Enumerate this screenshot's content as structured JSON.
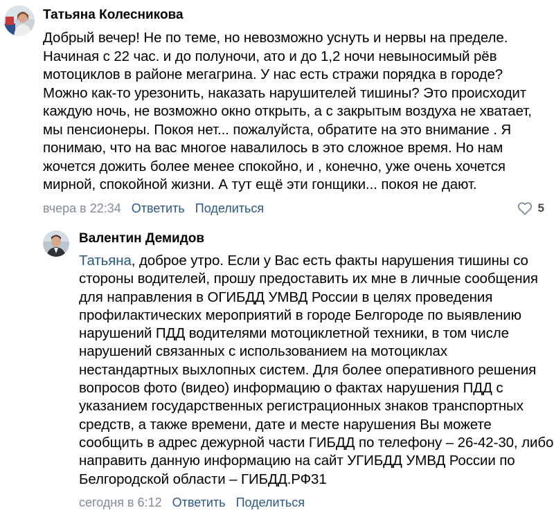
{
  "comments": [
    {
      "author": "Татьяна Колесникова",
      "lines": [
        "Добрый вечер! Не по теме, но невозможно уснуть и нервы на пределе.",
        "Начиная с 22 час. и до полуночи, ато и до 1,2 ночи невыносимый рёв",
        "мотоциклов в районе мегагрина. У нас есть стражи порядка в городе?",
        "Можно как-то урезонить, наказать нарушителей тишины? Это происходит",
        "каждую ночь, не возможно окно открыть, а с закрытым воздуха не хватает,",
        "мы пенсионеры. Покоя нет... пожалуйста, обратите на это внимание . Я",
        "понимаю, что на вас многое навалилось в это сложное время. Но нам",
        "жочется дожить более менее спокойно, и , конечно, уже очень хочется",
        "мирной, спокойной жизни. А тут ещё эти гонщики... покоя не дают."
      ],
      "time": "вчера в 22:34",
      "reply_label": "Ответить",
      "share_label": "Поделиться",
      "likes": "5"
    },
    {
      "author": "Валентин Демидов",
      "mention": "Татьяна",
      "first_line_rest": ", доброе утро. Если у Вас есть факты нарушения тишины со",
      "lines": [
        "стороны водителей, прошу предоставить их мне в личные сообщения",
        "для направления в ОГИБДД УМВД России в целях проведения",
        "профилактических мероприятий в городе Белгороде по выявлению",
        "нарушений ПДД водителями мотоциклетной техники, в том числе",
        "нарушений связанных с использованием на мотоциклах",
        "нестандартных выхлопных систем. Для более оперативного решения",
        "вопросов фото (видео) информацию о фактах нарушения ПДД с",
        "указанием государственных регистрационных знаков транспортных",
        "средств, а также времени, дате и месте нарушения Вы можете",
        "сообщить в адрес дежурной части ГИБДД по телефону – 26-42-30, либо",
        "направить данную информацию на сайт УГИБДД УМВД России по",
        "Белгородской области – ГИБДД.РФ31"
      ],
      "time": "сегодня в 6:12",
      "reply_label": "Ответить",
      "share_label": "Поделиться"
    }
  ],
  "colors": {
    "link": "#2a5885",
    "meta": "#818c99",
    "text": "#000000"
  },
  "icons": {
    "like": "heart-outline-icon"
  }
}
